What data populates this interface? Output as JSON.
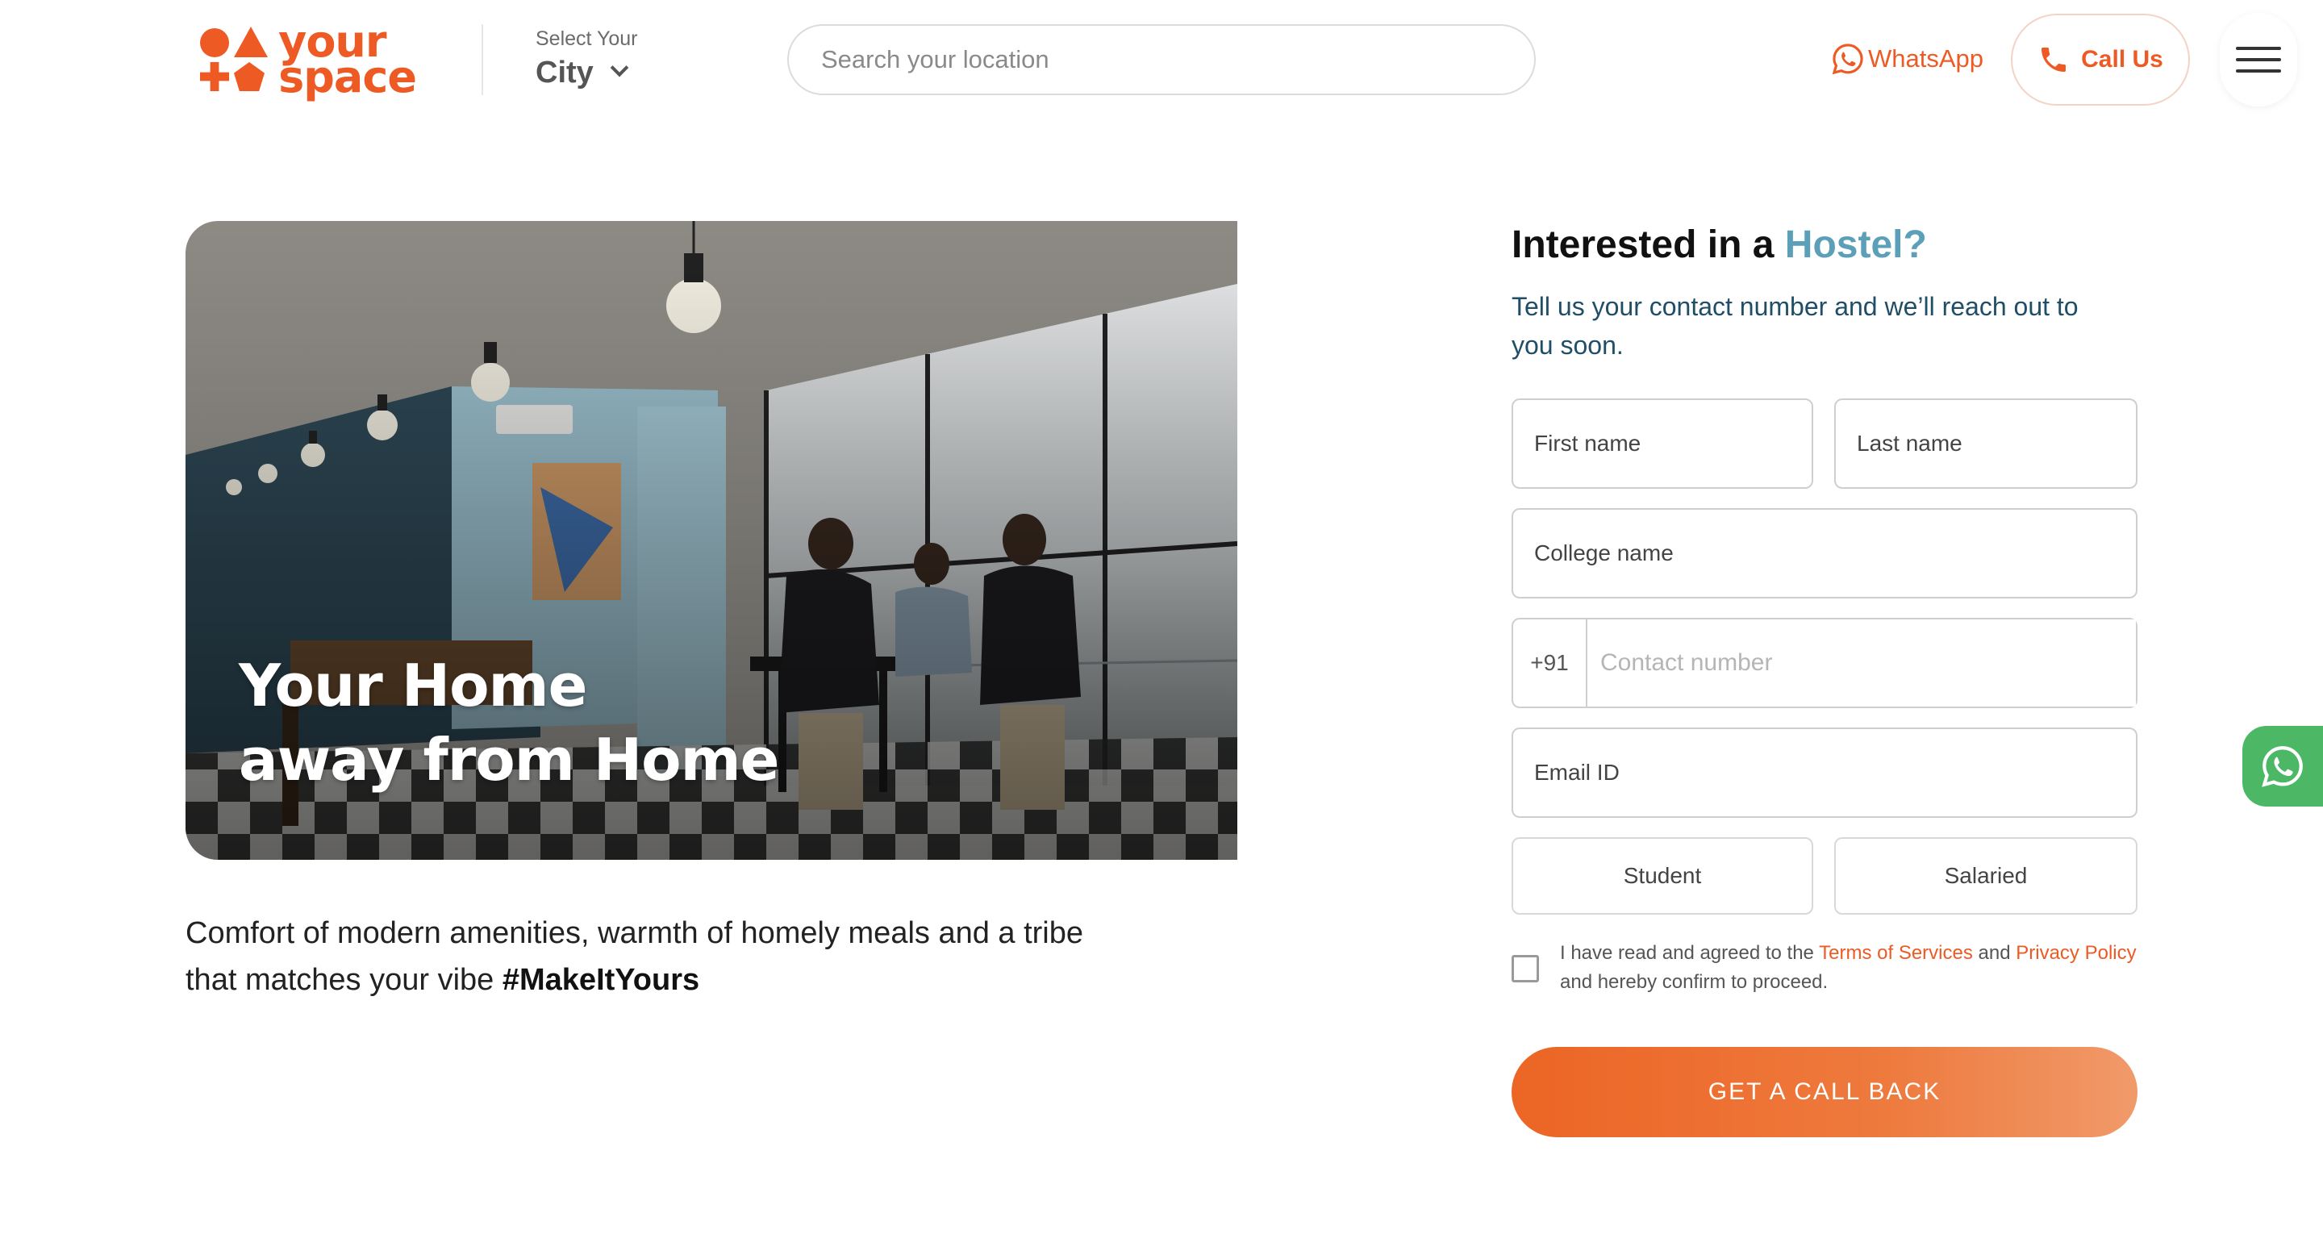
{
  "brand": {
    "line1": "your",
    "line2": "space",
    "color": "#ee5a24"
  },
  "city": {
    "caption": "Select Your",
    "value": "City"
  },
  "search": {
    "placeholder": "Search your location"
  },
  "header": {
    "whatsapp_label": "WhatsApp",
    "call_label": "Call Us"
  },
  "hero": {
    "title_line1": "Your Home",
    "title_line2": "away from Home",
    "description": "Comfort of modern amenities, warmth of homely meals and a tribe that matches your vibe",
    "hashtag": "#MakeItYours"
  },
  "form": {
    "title_prefix": "Interested in a",
    "title_accent": "Hostel?",
    "subtitle": "Tell us your contact number and we’ll reach out to you soon.",
    "first_name_placeholder": "First name",
    "last_name_placeholder": "Last name",
    "college_placeholder": "College name",
    "country_code": "+91",
    "contact_placeholder": "Contact number",
    "email_placeholder": "Email ID",
    "occupation_options": [
      "Student",
      "Salaried"
    ],
    "consent": {
      "text_before": "I have read and agreed to the",
      "terms_label": "Terms of Services",
      "and": "and",
      "privacy_label": "Privacy Policy",
      "text_after": "and hereby confirm to proceed."
    },
    "submit_label": "GET A CALL BACK"
  },
  "colors": {
    "accent": "#ee5a24",
    "title_accent": "#5b9fb8",
    "whatsapp_green": "#4cb866"
  },
  "icons": [
    "logo-mark-icon",
    "chevron-down-icon",
    "whatsapp-icon",
    "phone-icon",
    "hamburger-menu-icon",
    "whatsapp-float-icon"
  ]
}
